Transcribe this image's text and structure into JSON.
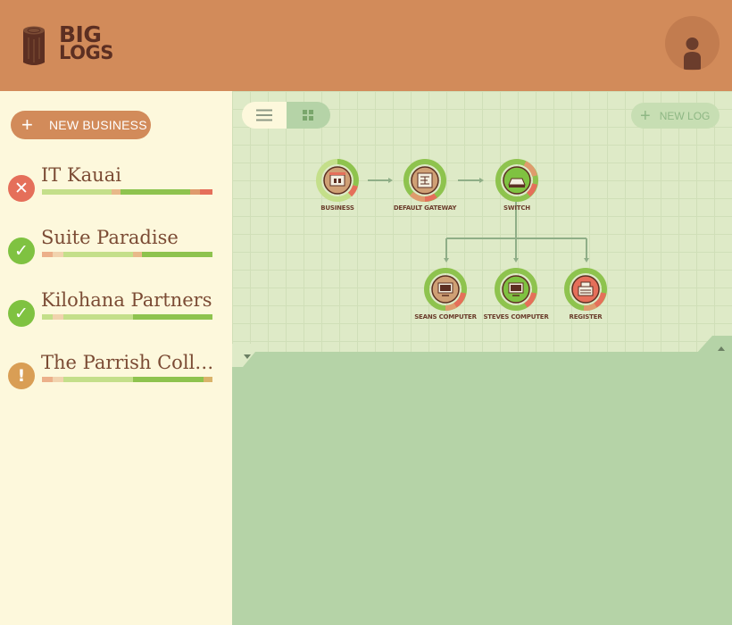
{
  "app": {
    "logo_line1": "BIG",
    "logo_line2": "LOGS"
  },
  "colors": {
    "header_bg": "#d28b5a",
    "sidebar_bg": "#fdf8dc",
    "canvas_bg": "#deeac7",
    "panel_bg": "#b5d3a7",
    "status_error": "#e56f5a",
    "status_ok": "#7fc241",
    "status_warning": "#d99e55",
    "text_brown": "#7b4b34"
  },
  "sidebar": {
    "new_business_label": "NEW BUSINESS",
    "businesses": [
      {
        "name": "IT Kauai",
        "status": "error",
        "icon": "x-icon"
      },
      {
        "name": "Suite Paradise",
        "status": "ok",
        "icon": "check-icon"
      },
      {
        "name": "Kilohana Partners",
        "status": "ok",
        "icon": "check-icon"
      },
      {
        "name": "The Parrish Colle...",
        "status": "warning",
        "icon": "exclamation-icon"
      }
    ]
  },
  "toolbar": {
    "list_view_icon": "list-icon",
    "grid_view_icon": "grid-icon",
    "new_log_label": "NEW LOG"
  },
  "diagram": {
    "nodes": [
      {
        "id": "business",
        "label": "BUSINESS",
        "icon": "store-icon"
      },
      {
        "id": "gateway",
        "label": "DEFAULT GATEWAY",
        "icon": "router-icon"
      },
      {
        "id": "switch",
        "label": "SWITCH",
        "icon": "switch-icon"
      },
      {
        "id": "seans",
        "label": "SEANS COMPUTER",
        "icon": "computer-icon"
      },
      {
        "id": "steves",
        "label": "STEVES COMPUTER",
        "icon": "computer-icon"
      },
      {
        "id": "register",
        "label": "REGISTER",
        "icon": "register-icon"
      }
    ]
  }
}
